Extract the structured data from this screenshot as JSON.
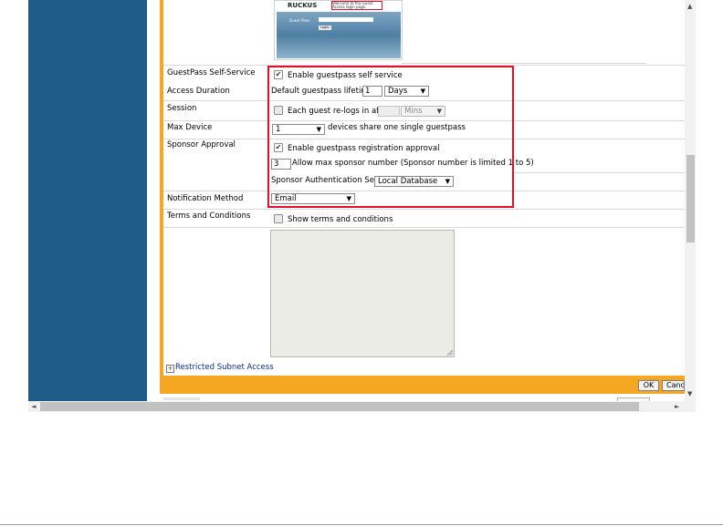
{
  "preview": {
    "brand": "RUCKUS",
    "welcome": "Welcome to the Guest Access login page.",
    "guest_pass_label": "Guest Pass",
    "login_button": "Login"
  },
  "form": {
    "guestpass_self_service": {
      "label": "GuestPass Self-Service",
      "checkbox_label": "Enable guestpass self service",
      "checked": true
    },
    "access_duration": {
      "label": "Access Duration",
      "lifetime_label": "Default guestpass lifetime",
      "value": "1",
      "unit": "Days"
    },
    "session": {
      "label": "Session",
      "checkbox_label": "Each guest re-logs in after",
      "checked": false,
      "value": "",
      "unit": "Mins"
    },
    "max_device": {
      "label": "Max Device",
      "value": "1",
      "suffix": "devices share one single guestpass"
    },
    "sponsor_approval": {
      "label": "Sponsor Approval",
      "checkbox_label": "Enable guestpass registration approval",
      "checked": true,
      "sponsor_number": "3",
      "sponsor_number_label": "Allow max sponsor number (Sponsor number is limited 1 to 5)",
      "auth_server_label": "Sponsor Authentication Server",
      "auth_server": "Local Database"
    },
    "notification_method": {
      "label": "Notification Method",
      "value": "Email"
    },
    "terms": {
      "label": "Terms and Conditions",
      "checkbox_label": "Show terms and conditions",
      "checked": false
    }
  },
  "restricted_subnet": {
    "expander": "+",
    "label": "Restricted Subnet Access"
  },
  "buttons": {
    "ok": "OK",
    "cancel": "Cancel"
  },
  "icons": {
    "check": "✔",
    "caret": "▼",
    "scroll_up": "▲",
    "scroll_down": "▼",
    "scroll_left": "◄",
    "scroll_right": "►"
  }
}
